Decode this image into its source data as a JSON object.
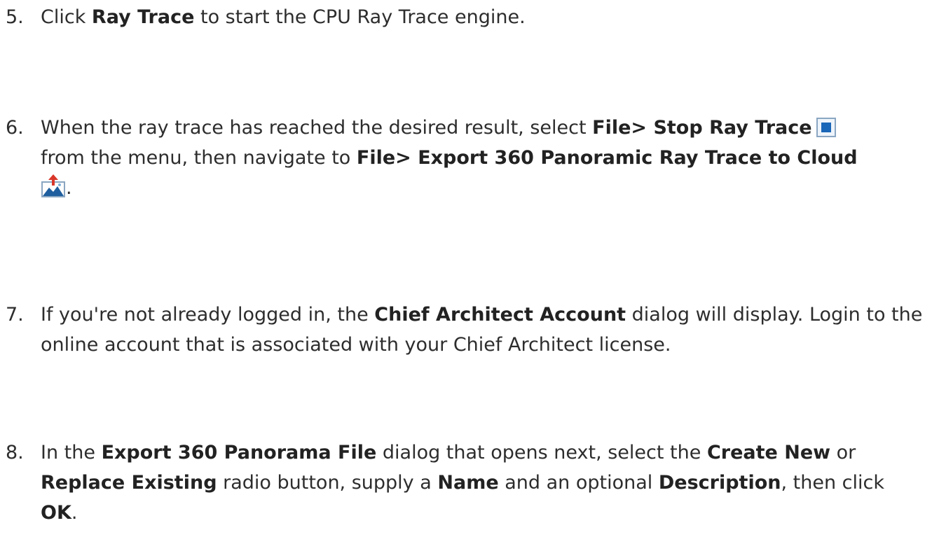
{
  "steps": [
    {
      "number": "5.",
      "parts": [
        "Click ",
        "Ray Trace",
        " to start the CPU Ray Trace engine."
      ]
    },
    {
      "number": "6.",
      "parts": [
        "When the ray trace has reached the desired result, select ",
        "File> Stop Ray Trace",
        "from the menu, then navigate to ",
        "File> Export 360 Panoramic Ray Trace to Cloud",
        "."
      ],
      "icons": [
        "stop-ray-trace-icon",
        "export-panorama-cloud-icon"
      ]
    },
    {
      "number": "7.",
      "parts": [
        "If you're not already logged in, the ",
        "Chief Architect Account",
        " dialog will display. Login to the online account that is associated with your Chief Architect license."
      ]
    },
    {
      "number": "8.",
      "parts": [
        "In the ",
        "Export 360 Panorama File",
        " dialog that opens next, select the ",
        "Create New",
        " or ",
        "Replace Existing",
        " radio button, supply a ",
        "Name",
        " and an optional ",
        "Description",
        ", then click ",
        "OK",
        "."
      ]
    }
  ],
  "colors": {
    "text": "#2d2d2d",
    "stop_icon_fill": "#1a66b8",
    "export_icon_arrow": "#d9372a",
    "export_icon_mountains": "#1f5e9e"
  }
}
